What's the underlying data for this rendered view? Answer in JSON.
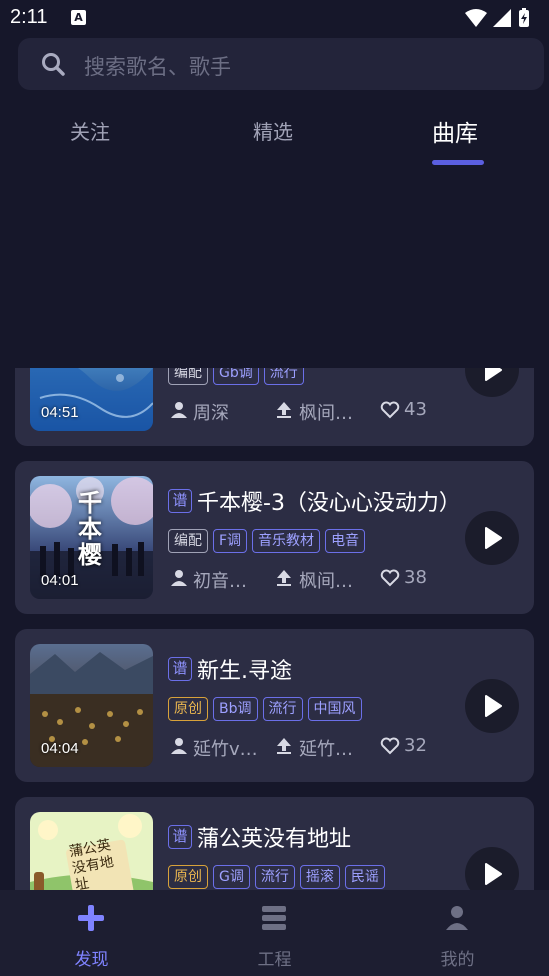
{
  "status_bar": {
    "time": "2:11",
    "notification_icon": "A"
  },
  "search": {
    "placeholder": "搜索歌名、歌手"
  },
  "tabs": [
    {
      "label": "关注",
      "active": false
    },
    {
      "label": "精选",
      "active": false
    },
    {
      "label": "曲库",
      "active": true
    }
  ],
  "songs": [
    {
      "title": "",
      "duration": "04:51",
      "tags": [
        {
          "label": "编配",
          "style": "gray"
        },
        {
          "label": "Gb调",
          "style": "blue"
        },
        {
          "label": "流行",
          "style": "blue"
        }
      ],
      "author": "周深",
      "uploader": "枫间…",
      "likes": "43"
    },
    {
      "badge": "谱",
      "title": "千本樱-3（没心心没动力）",
      "duration": "04:01",
      "tags": [
        {
          "label": "编配",
          "style": "gray"
        },
        {
          "label": "F调",
          "style": "blue"
        },
        {
          "label": "音乐教材",
          "style": "blue"
        },
        {
          "label": "电音",
          "style": "blue"
        }
      ],
      "author": "初音…",
      "uploader": "枫间…",
      "likes": "38"
    },
    {
      "badge": "谱",
      "title": "新生.寻途",
      "duration": "04:04",
      "tags": [
        {
          "label": "原创",
          "style": "gold"
        },
        {
          "label": "Bb调",
          "style": "blue"
        },
        {
          "label": "流行",
          "style": "blue"
        },
        {
          "label": "中国风",
          "style": "blue"
        }
      ],
      "author": "延竹v…",
      "uploader": "延竹…",
      "likes": "32"
    },
    {
      "badge": "谱",
      "title": "蒲公英没有地址",
      "duration": "",
      "tags": [
        {
          "label": "原创",
          "style": "gold"
        },
        {
          "label": "G调",
          "style": "blue"
        },
        {
          "label": "流行",
          "style": "blue"
        },
        {
          "label": "摇滚",
          "style": "blue"
        },
        {
          "label": "民谣",
          "style": "blue"
        }
      ],
      "author": "",
      "uploader": "",
      "likes": ""
    }
  ],
  "thumb_text": {
    "song2": "千本樱",
    "song4": "蒲公英没有地址"
  },
  "bottom_nav": [
    {
      "label": "发现",
      "icon": "plus-icon",
      "active": true
    },
    {
      "label": "工程",
      "icon": "stack-icon",
      "active": false
    },
    {
      "label": "我的",
      "icon": "person-icon",
      "active": false
    }
  ],
  "colors": {
    "accent": "#5b5fe0",
    "background": "#16172a",
    "card": "#2c2d44",
    "gold_tag": "#d8a23a"
  }
}
